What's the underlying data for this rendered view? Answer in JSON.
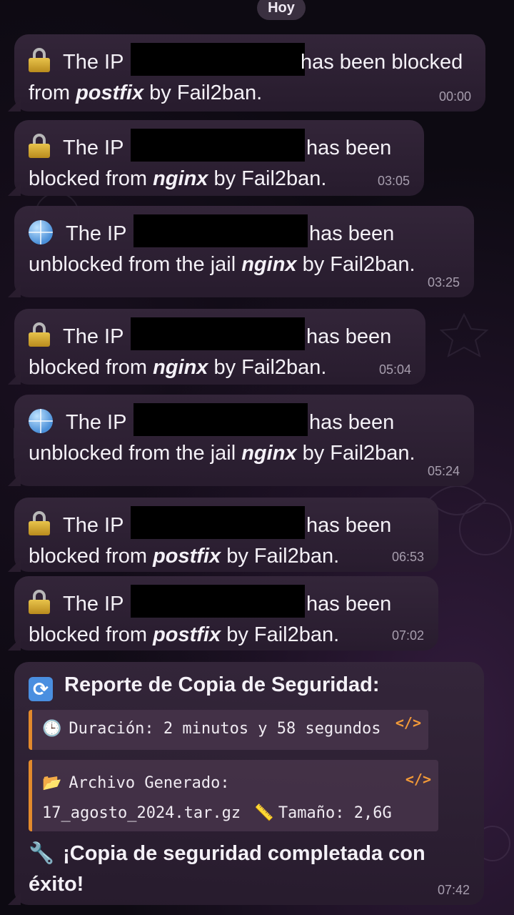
{
  "date_chip": "Hoy",
  "messages": [
    {
      "icon": "lock-icon",
      "pre": "The IP",
      "post": "has been blocked",
      "line2_pre": "from ",
      "service": "postfix",
      "line2_post": " by Fail2ban.",
      "time": "00:00"
    },
    {
      "icon": "lock-icon",
      "pre": "The IP",
      "post": "has been",
      "line2_pre": "blocked from ",
      "service": "nginx",
      "line2_post": " by Fail2ban.",
      "time": "03:05"
    },
    {
      "icon": "globe-icon",
      "pre": "The IP",
      "post": "has been",
      "line2_pre": "unblocked from the jail ",
      "service": "nginx",
      "line2_post": " by Fail2ban.",
      "time": "03:25"
    },
    {
      "icon": "lock-icon",
      "pre": "The IP",
      "post": "has been",
      "line2_pre": "blocked from ",
      "service": "nginx",
      "line2_post": " by Fail2ban.",
      "time": "05:04"
    },
    {
      "icon": "globe-icon",
      "pre": "The IP",
      "post": "has been",
      "line2_pre": "unblocked from the jail ",
      "service": "nginx",
      "line2_post": " by Fail2ban.",
      "time": "05:24"
    },
    {
      "icon": "lock-icon",
      "pre": "The IP",
      "post": "has been",
      "line2_pre": "blocked from ",
      "service": "postfix",
      "line2_post": " by Fail2ban.",
      "time": "06:53"
    },
    {
      "icon": "lock-icon",
      "pre": "The IP",
      "post": "has been",
      "line2_pre": "blocked from ",
      "service": "postfix",
      "line2_post": " by Fail2ban.",
      "time": "07:02"
    }
  ],
  "report": {
    "title": "Reporte de Copia de Seguridad:",
    "duration": "Duración: 2 minutos y 58 segundos",
    "archive_label": "Archivo Generado:",
    "archive_file": "17_agosto_2024.tar.gz",
    "size": "Tamaño: 2,6G",
    "code_tag": "</>",
    "final_line1": "¡Copia de seguridad completada con",
    "final_line2": "éxito!",
    "time": "07:42"
  },
  "icons": {
    "lock": "lock-icon",
    "globe": "globe-icon",
    "refresh": "refresh-icon",
    "clock": "clock-icon",
    "folder": "folder-icon",
    "ruler": "ruler-icon",
    "wrench": "wrench-icon"
  },
  "colors": {
    "accent_orange": "#e38a2c",
    "bubble": "#34263a",
    "background": "#0d0a12",
    "timestamp": "#a79eae"
  }
}
